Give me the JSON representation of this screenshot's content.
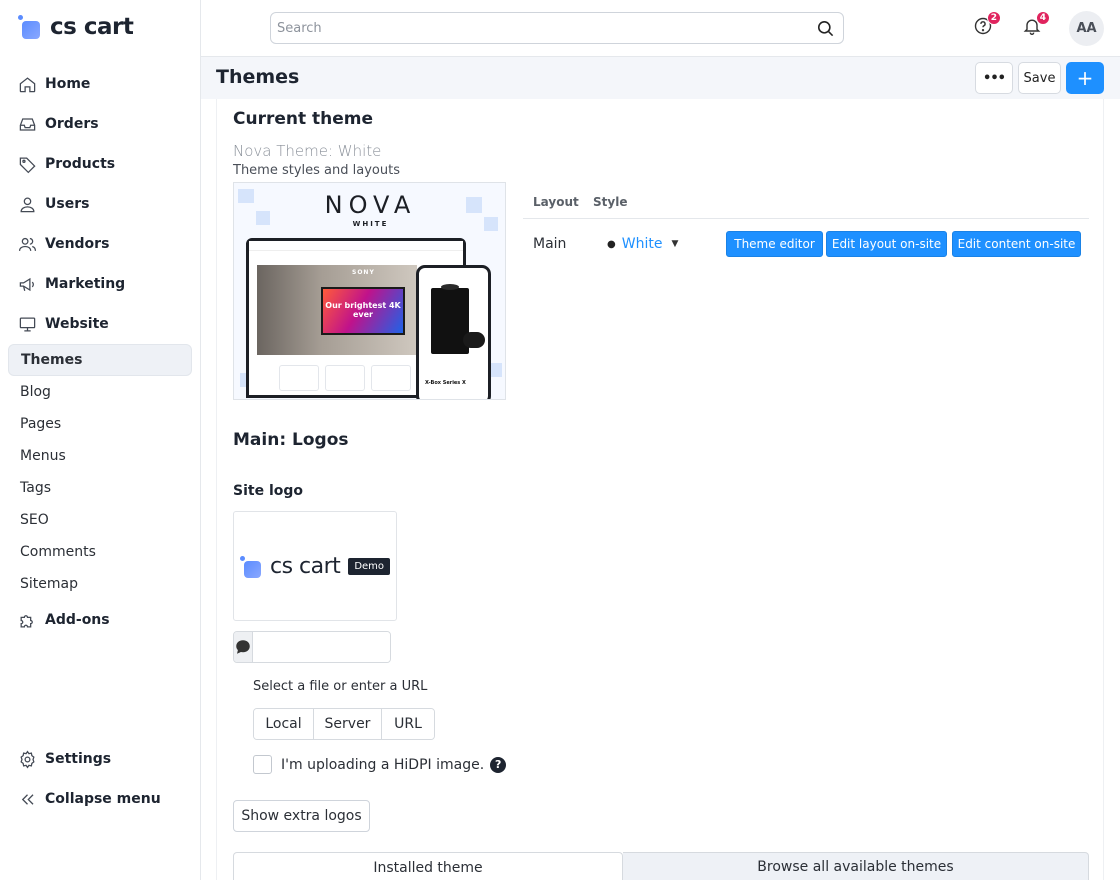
{
  "brand": {
    "name": "cs cart"
  },
  "sidebar": {
    "main_items": [
      {
        "label": "Home",
        "icon": "home-icon"
      },
      {
        "label": "Orders",
        "icon": "inbox-icon"
      },
      {
        "label": "Products",
        "icon": "tag-icon"
      },
      {
        "label": "Users",
        "icon": "user-icon"
      },
      {
        "label": "Vendors",
        "icon": "users-icon"
      },
      {
        "label": "Marketing",
        "icon": "megaphone-icon"
      },
      {
        "label": "Website",
        "icon": "monitor-icon"
      }
    ],
    "website_sub": [
      "Themes",
      "Blog",
      "Pages",
      "Menus",
      "Tags",
      "SEO",
      "Comments",
      "Sitemap"
    ],
    "addons": {
      "label": "Add-ons",
      "icon": "puzzle-icon"
    },
    "settings": {
      "label": "Settings",
      "icon": "gear-icon"
    },
    "collapse": {
      "label": "Collapse menu",
      "icon": "double-chevron-left-icon"
    }
  },
  "topbar": {
    "search_placeholder": "Search",
    "help_badge": "2",
    "notifications_badge": "4",
    "avatar_initials": "AA"
  },
  "page": {
    "title": "Themes",
    "more_label": "•••",
    "save_label": "Save",
    "add_label": "+"
  },
  "current_theme": {
    "heading": "Current theme",
    "name": "Nova Theme: White",
    "description": "Theme styles and layouts",
    "preview": {
      "title": "NOVA",
      "subtitle": "WHITE",
      "hero_text": "Our brightest 4K ever",
      "brand_on_tv": "SONY",
      "phone_product": "X-Box Series X"
    }
  },
  "layout_table": {
    "headers": {
      "layout": "Layout",
      "style": "Style"
    },
    "rows": [
      {
        "layout": "Main",
        "style": "White",
        "buttons": [
          "Theme editor",
          "Edit layout on-site",
          "Edit content on-site"
        ]
      }
    ]
  },
  "logos": {
    "heading": "Main: Logos",
    "site_logo_label": "Site logo",
    "logo_text": "cs cart",
    "demo_tag": "Demo",
    "select_label": "Select a file or enter a URL",
    "sources": [
      "Local",
      "Server",
      "URL"
    ],
    "hidpi_label": "I'm uploading a HiDPI image.",
    "extra_button": "Show extra logos"
  },
  "tabs": [
    "Installed theme",
    "Browse all available themes"
  ],
  "colors": {
    "accent": "#1e90ff",
    "badge": "#e0245e",
    "dark": "#1d2430"
  }
}
